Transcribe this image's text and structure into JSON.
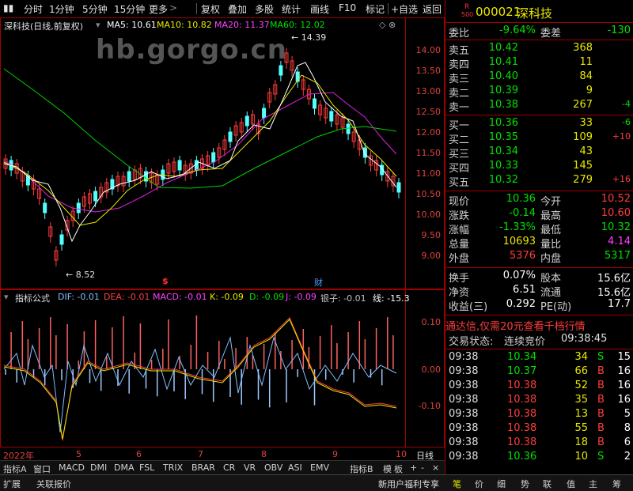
{
  "toolbar": {
    "items": [
      "分时",
      "1分钟",
      "5分钟",
      "15分钟",
      "更多",
      "复权",
      "叠加",
      "多股",
      "统计",
      "画线",
      "F10",
      "标记",
      "+自选",
      "返回"
    ]
  },
  "watermark": "hb.gorgo.cn",
  "kchart": {
    "title": "深科技(日线,前复权)",
    "ma": [
      {
        "label": "MA5: 10.61",
        "color": "#ffffff"
      },
      {
        "label": "MA10: 10.82",
        "color": "#e8e800"
      },
      {
        "label": "MA20: 11.37",
        "color": "#ff40ff"
      },
      {
        "label": "MA60: 12.02",
        "color": "#00e000"
      }
    ],
    "high_label": "14.39",
    "low_label": "8.52",
    "yticks": [
      "14.00",
      "13.50",
      "13.00",
      "12.50",
      "12.00",
      "11.50",
      "11.00",
      "10.50",
      "10.00",
      "9.50",
      "9.00"
    ],
    "marker_s": "$",
    "marker_cai": "财"
  },
  "indicator": {
    "name": "指标公式",
    "items": [
      {
        "label": "DIF: -0.01",
        "color": "#80c0ff"
      },
      {
        "label": "DEA: -0.01",
        "color": "#ff4040"
      },
      {
        "label": "MACD: -0.01",
        "color": "#ff40ff"
      },
      {
        "label": "K: -0.09",
        "color": "#e8e800"
      },
      {
        "label": "D: -0.09",
        "color": "#00e000"
      },
      {
        "label": "J: -0.09",
        "color": "#ff40ff"
      },
      {
        "label": "银子: -0.01",
        "color": "#c0c0c0"
      },
      {
        "label": "线: -15.3",
        "color": "#ffffff"
      }
    ],
    "yticks": [
      "0.10",
      "0.00",
      "-0.10"
    ]
  },
  "datebar": {
    "labels": [
      "2022年",
      "5",
      "6",
      "7",
      "8",
      "9",
      "10"
    ],
    "period": "日线"
  },
  "tabs": [
    "指标A",
    "窗口",
    "MACD",
    "DMI",
    "DMA",
    "FSL",
    "TRIX",
    "BRAR",
    "CR",
    "VR",
    "OBV",
    "ASI",
    "EMV",
    "指标B",
    "模",
    "板",
    "+",
    "-",
    "×"
  ],
  "statusbar": {
    "left": [
      "扩展",
      "关联报价"
    ],
    "right_text": "新用户福利专享",
    "right_tabs": [
      "笔",
      "价",
      "细",
      "势",
      "联",
      "值",
      "主",
      "筹"
    ]
  },
  "panel": {
    "code": "000021",
    "name": "深科技",
    "badge_r": "R",
    "badge_num": "500",
    "weibi_label": "委比",
    "weibi": "-9.64%",
    "weicha_label": "委差",
    "weicha": "-130",
    "asks": [
      {
        "label": "卖五",
        "price": "10.42",
        "vol": "368",
        "chg": ""
      },
      {
        "label": "卖四",
        "price": "10.41",
        "vol": "11",
        "chg": ""
      },
      {
        "label": "卖三",
        "price": "10.40",
        "vol": "84",
        "chg": ""
      },
      {
        "label": "卖二",
        "price": "10.39",
        "vol": "9",
        "chg": ""
      },
      {
        "label": "卖一",
        "price": "10.38",
        "vol": "267",
        "chg": "-4"
      }
    ],
    "bids": [
      {
        "label": "买一",
        "price": "10.36",
        "vol": "33",
        "chg": "-6"
      },
      {
        "label": "买二",
        "price": "10.35",
        "vol": "109",
        "chg": "+10"
      },
      {
        "label": "买三",
        "price": "10.34",
        "vol": "43",
        "chg": ""
      },
      {
        "label": "买四",
        "price": "10.33",
        "vol": "145",
        "chg": ""
      },
      {
        "label": "买五",
        "price": "10.32",
        "vol": "279",
        "chg": "+16"
      }
    ],
    "stats": [
      {
        "l1": "现价",
        "v1": "10.36",
        "c1": "green",
        "l2": "今开",
        "v2": "10.52",
        "c2": "red"
      },
      {
        "l1": "涨跌",
        "v1": "-0.14",
        "c1": "green",
        "l2": "最高",
        "v2": "10.60",
        "c2": "red"
      },
      {
        "l1": "涨幅",
        "v1": "-1.33%",
        "c1": "green",
        "l2": "最低",
        "v2": "10.32",
        "c2": "green"
      },
      {
        "l1": "总量",
        "v1": "10693",
        "c1": "yellow",
        "l2": "量比",
        "v2": "4.14",
        "c2": "magenta"
      },
      {
        "l1": "外盘",
        "v1": "5376",
        "c1": "red",
        "l2": "内盘",
        "v2": "5317",
        "c2": "green"
      }
    ],
    "fund": [
      {
        "l1": "换手",
        "v1": "0.07%",
        "l2": "股本",
        "v2": "15.6亿"
      },
      {
        "l1": "净资",
        "v1": "6.51",
        "l2": "流通",
        "v2": "15.6亿"
      },
      {
        "l1": "收益(三)",
        "v1": "0.292",
        "l2": "PE(动)",
        "v2": "17.7"
      }
    ],
    "ad": "通达信,仅需20元查看千档行情",
    "trade_status_label": "交易状态:",
    "trade_status": "连续竞价",
    "trade_time": "09:38:45",
    "ticks": [
      {
        "t": "09:38",
        "p": "10.34",
        "v": "34",
        "s": "S",
        "n": "15"
      },
      {
        "t": "09:38",
        "p": "10.37",
        "v": "66",
        "s": "B",
        "n": "16"
      },
      {
        "t": "09:38",
        "p": "10.38",
        "v": "52",
        "s": "B",
        "n": "16"
      },
      {
        "t": "09:38",
        "p": "10.38",
        "v": "35",
        "s": "B",
        "n": "16"
      },
      {
        "t": "09:38",
        "p": "10.38",
        "v": "13",
        "s": "B",
        "n": "5"
      },
      {
        "t": "09:38",
        "p": "10.38",
        "v": "55",
        "s": "B",
        "n": "8"
      },
      {
        "t": "09:38",
        "p": "10.38",
        "v": "18",
        "s": "B",
        "n": "6"
      },
      {
        "t": "09:38",
        "p": "10.36",
        "v": "10",
        "s": "S",
        "n": "2"
      }
    ]
  }
}
